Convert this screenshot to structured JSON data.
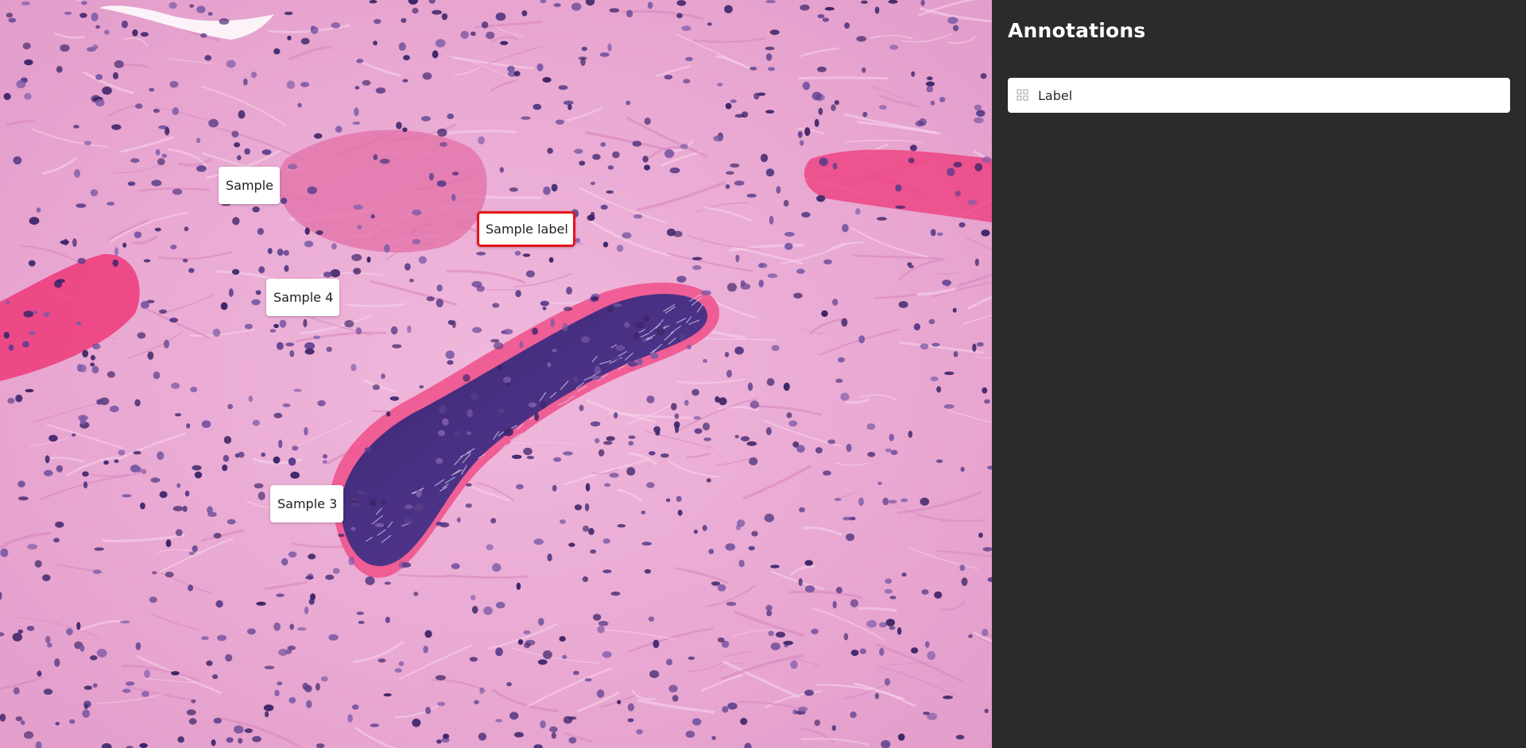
{
  "sidebar": {
    "title": "Annotations",
    "label_field": {
      "value": "Label",
      "icon": "grid-icon"
    }
  },
  "viewer": {
    "labels": [
      {
        "text": "Sample",
        "selected": false
      },
      {
        "text": "Sample label",
        "selected": true
      },
      {
        "text": "Sample 4",
        "selected": false
      },
      {
        "text": "Sample 3",
        "selected": false
      }
    ]
  },
  "colors": {
    "sidebar_bg": "#2b2b2b",
    "selection_border": "#e5131b",
    "tissue_bg": "#e8a6cf",
    "nuclei": "#4a2f78",
    "blood": "#ee3f7e"
  }
}
